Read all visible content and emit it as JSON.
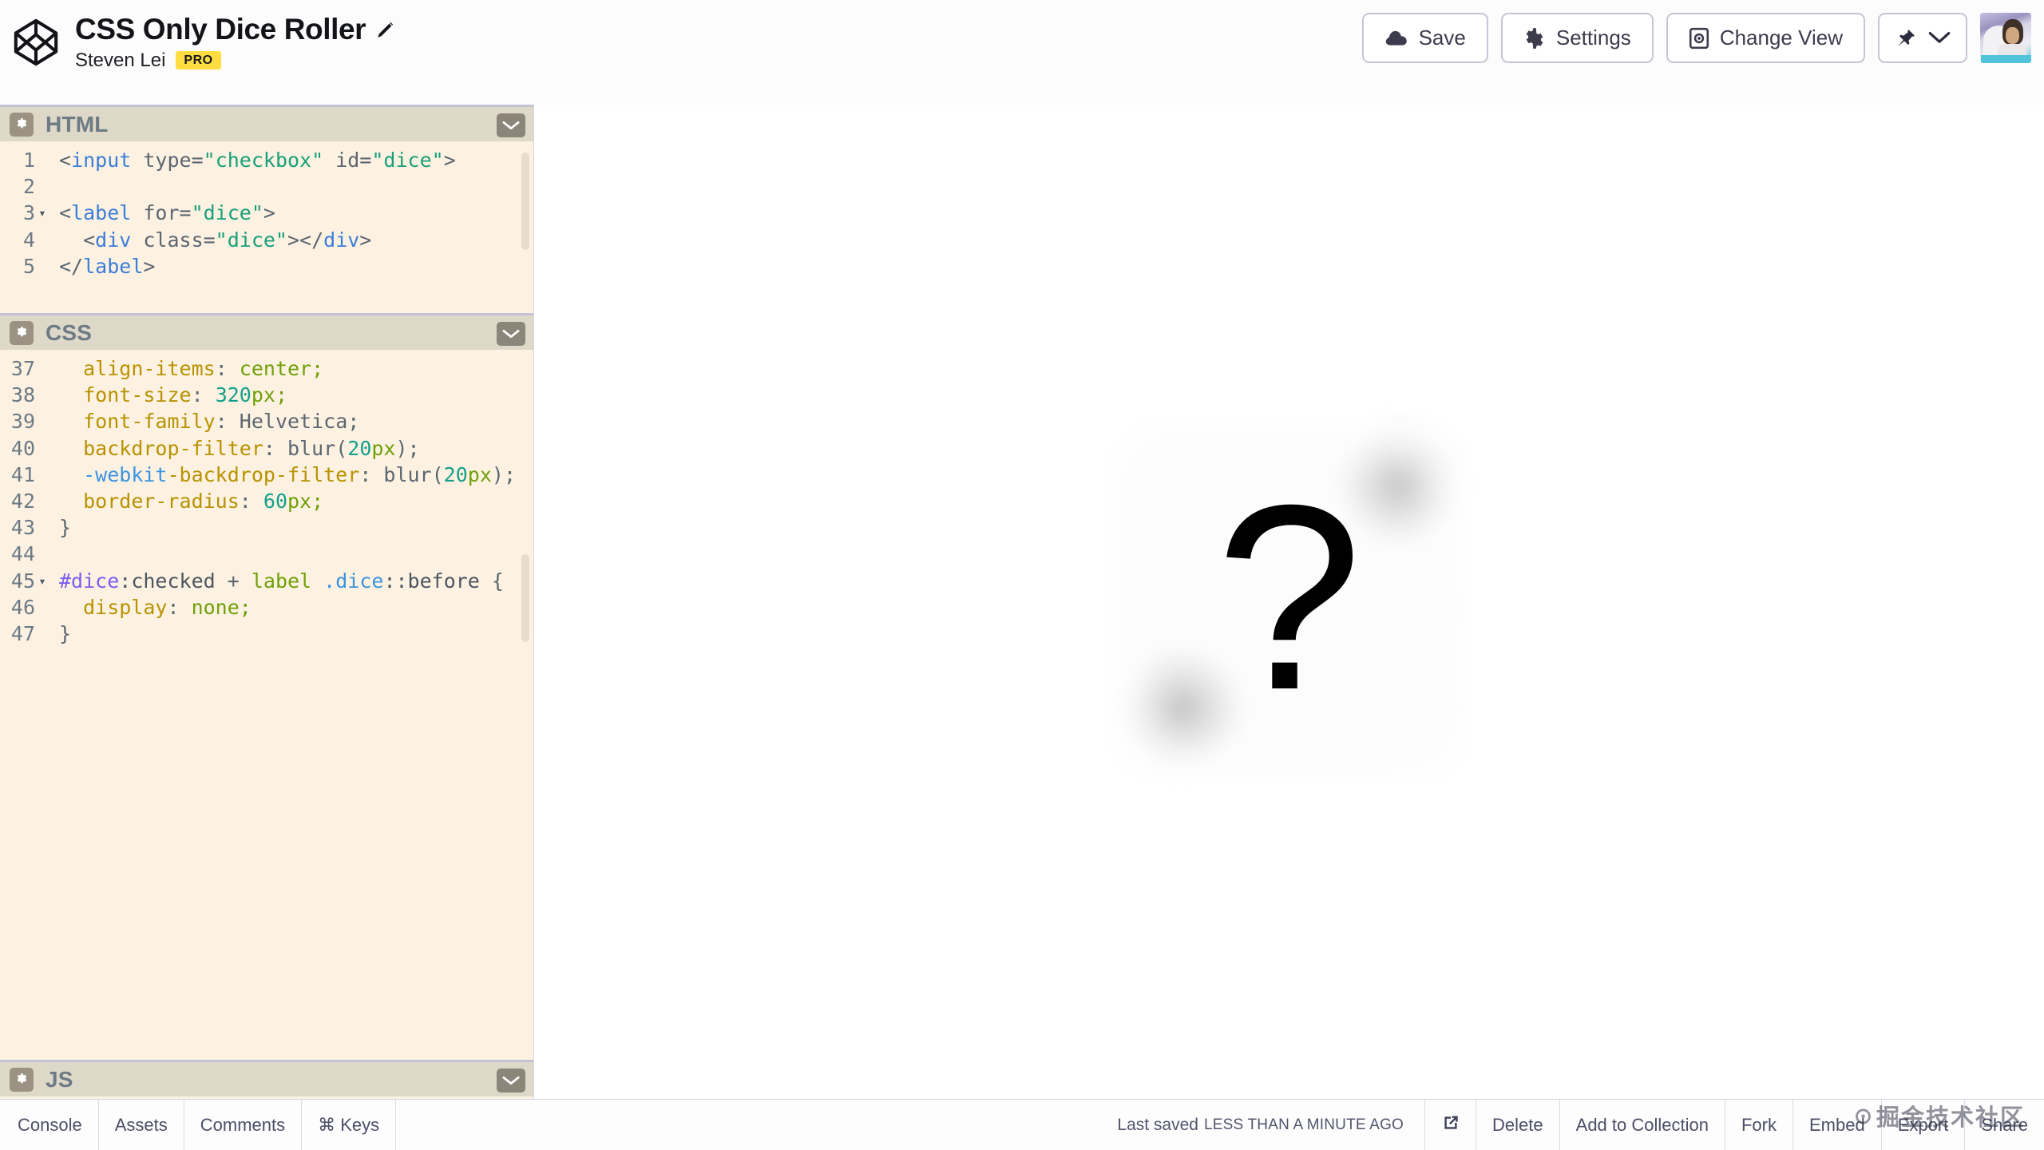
{
  "header": {
    "pen_title": "CSS Only Dice Roller",
    "author": "Steven Lei",
    "pro_badge": "PRO",
    "edit_icon": "pencil-icon",
    "logo_icon": "codepen-logo-icon"
  },
  "toolbar": {
    "save_label": "Save",
    "settings_label": "Settings",
    "change_view_label": "Change View",
    "save_icon": "cloud-icon",
    "settings_icon": "gear-icon",
    "change_view_icon": "layout-display-icon",
    "pin_icon": "pin-icon",
    "pin_chevron_icon": "chevron-down-icon",
    "avatar_name": "user-avatar"
  },
  "editors": {
    "html": {
      "label": "HTML",
      "settings_icon": "gear-icon",
      "collapse_icon": "chevron-down-icon",
      "lines": [
        {
          "n": "1",
          "fold": "",
          "tokens": [
            {
              "t": "<",
              "c": "t-punct"
            },
            {
              "t": "input",
              "c": "t-tag"
            },
            {
              "t": " type=",
              "c": "t-attr"
            },
            {
              "t": "\"checkbox\"",
              "c": "t-str"
            },
            {
              "t": " id=",
              "c": "t-attr"
            },
            {
              "t": "\"dice\"",
              "c": "t-str"
            },
            {
              "t": ">",
              "c": "t-punct"
            }
          ]
        },
        {
          "n": "2",
          "fold": "",
          "tokens": []
        },
        {
          "n": "3",
          "fold": "▾",
          "tokens": [
            {
              "t": "<",
              "c": "t-punct"
            },
            {
              "t": "label",
              "c": "t-tag"
            },
            {
              "t": " for=",
              "c": "t-attr"
            },
            {
              "t": "\"dice\"",
              "c": "t-str"
            },
            {
              "t": ">",
              "c": "t-punct"
            }
          ]
        },
        {
          "n": "4",
          "fold": "",
          "tokens": [
            {
              "t": "  <",
              "c": "t-punct"
            },
            {
              "t": "div",
              "c": "t-tag"
            },
            {
              "t": " class=",
              "c": "t-attr"
            },
            {
              "t": "\"dice\"",
              "c": "t-str"
            },
            {
              "t": "></",
              "c": "t-punct"
            },
            {
              "t": "div",
              "c": "t-tag"
            },
            {
              "t": ">",
              "c": "t-punct"
            }
          ]
        },
        {
          "n": "5",
          "fold": "",
          "tokens": [
            {
              "t": "</",
              "c": "t-punct"
            },
            {
              "t": "label",
              "c": "t-tag"
            },
            {
              "t": ">",
              "c": "t-punct"
            }
          ]
        }
      ]
    },
    "css": {
      "label": "CSS",
      "settings_icon": "gear-icon",
      "collapse_icon": "chevron-down-icon",
      "lines": [
        {
          "n": "37",
          "fold": "",
          "tokens": [
            {
              "t": "  ",
              "c": "t-plain"
            },
            {
              "t": "align-items",
              "c": "t-prop"
            },
            {
              "t": ": ",
              "c": "t-plain"
            },
            {
              "t": "center",
              "c": "t-val"
            },
            {
              "t": ";",
              "c": "t-val"
            }
          ]
        },
        {
          "n": "38",
          "fold": "",
          "tokens": [
            {
              "t": "  ",
              "c": "t-plain"
            },
            {
              "t": "font-size",
              "c": "t-prop"
            },
            {
              "t": ": ",
              "c": "t-plain"
            },
            {
              "t": "320",
              "c": "t-num"
            },
            {
              "t": "px",
              "c": "t-unit"
            },
            {
              "t": ";",
              "c": "t-unit"
            }
          ]
        },
        {
          "n": "39",
          "fold": "",
          "tokens": [
            {
              "t": "  ",
              "c": "t-plain"
            },
            {
              "t": "font-family",
              "c": "t-prop"
            },
            {
              "t": ": ",
              "c": "t-plain"
            },
            {
              "t": "Helvetica;",
              "c": "t-plain"
            }
          ]
        },
        {
          "n": "40",
          "fold": "",
          "tokens": [
            {
              "t": "  ",
              "c": "t-plain"
            },
            {
              "t": "backdrop-filter",
              "c": "t-prop"
            },
            {
              "t": ": ",
              "c": "t-plain"
            },
            {
              "t": "blur(",
              "c": "t-fn"
            },
            {
              "t": "20",
              "c": "t-num"
            },
            {
              "t": "px",
              "c": "t-unit"
            },
            {
              "t": ");",
              "c": "t-fn"
            }
          ]
        },
        {
          "n": "41",
          "fold": "",
          "tokens": [
            {
              "t": "  ",
              "c": "t-plain"
            },
            {
              "t": "-webkit",
              "c": "t-vendor"
            },
            {
              "t": "-backdrop-filter",
              "c": "t-prop"
            },
            {
              "t": ": ",
              "c": "t-plain"
            },
            {
              "t": "blur(",
              "c": "t-fn"
            },
            {
              "t": "20",
              "c": "t-num"
            },
            {
              "t": "px",
              "c": "t-unit"
            },
            {
              "t": ");",
              "c": "t-fn"
            }
          ]
        },
        {
          "n": "42",
          "fold": "",
          "tokens": [
            {
              "t": "  ",
              "c": "t-plain"
            },
            {
              "t": "border-radius",
              "c": "t-prop"
            },
            {
              "t": ": ",
              "c": "t-plain"
            },
            {
              "t": "60",
              "c": "t-num"
            },
            {
              "t": "px",
              "c": "t-unit"
            },
            {
              "t": ";",
              "c": "t-unit"
            }
          ]
        },
        {
          "n": "43",
          "fold": "",
          "tokens": [
            {
              "t": "}",
              "c": "t-plain"
            }
          ]
        },
        {
          "n": "44",
          "fold": "",
          "tokens": []
        },
        {
          "n": "45",
          "fold": "▾",
          "tokens": [
            {
              "t": "#dice",
              "c": "t-id"
            },
            {
              "t": ":checked",
              "c": "t-pseudo"
            },
            {
              "t": " + ",
              "c": "t-plain"
            },
            {
              "t": "label",
              "c": "t-elem"
            },
            {
              "t": " ",
              "c": "t-plain"
            },
            {
              "t": ".dice",
              "c": "t-class"
            },
            {
              "t": "::before",
              "c": "t-pseudo"
            },
            {
              "t": " {",
              "c": "t-plain"
            }
          ]
        },
        {
          "n": "46",
          "fold": "",
          "tokens": [
            {
              "t": "  ",
              "c": "t-plain"
            },
            {
              "t": "display",
              "c": "t-prop"
            },
            {
              "t": ": ",
              "c": "t-plain"
            },
            {
              "t": "none",
              "c": "t-val"
            },
            {
              "t": ";",
              "c": "t-val"
            }
          ]
        },
        {
          "n": "47",
          "fold": "",
          "tokens": [
            {
              "t": "}",
              "c": "t-plain"
            }
          ]
        }
      ]
    },
    "js": {
      "label": "JS",
      "settings_icon": "gear-icon",
      "collapse_icon": "chevron-down-icon"
    }
  },
  "preview": {
    "dice_face": "?",
    "pips_visible": 2
  },
  "footer": {
    "left_items": [
      "Console",
      "Assets",
      "Comments",
      "⌘ Keys"
    ],
    "saved_lead": "Last saved",
    "saved_stamp": "LESS THAN A MINUTE AGO",
    "external_icon": "external-link-icon",
    "right_items": [
      "Delete",
      "Add to Collection",
      "Fork",
      "Embed",
      "Export",
      "Share"
    ]
  },
  "watermark": {
    "text": "☉掘金技术社区"
  },
  "colors": {
    "pro_badge_bg": "#ffdd40",
    "editor_bg": "#fdf2e2",
    "panel_head_bg": "#ddd8c8",
    "panel_divider": "#c3c2d4",
    "button_border": "#c6c5d3"
  }
}
